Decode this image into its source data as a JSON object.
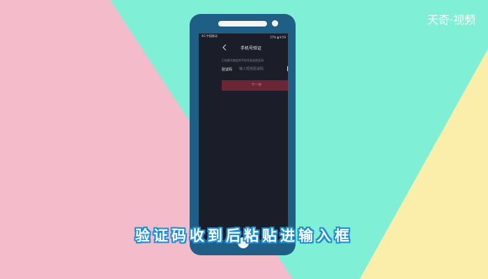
{
  "colors": {
    "pink": "#f4bccb",
    "mint": "#7ff0d6",
    "yellow": "#fbeeaa",
    "phone_body": "#1f5f86",
    "screen": "#1b1e29",
    "next_button": "#6b2535",
    "caption_outline": "#1a8fd8"
  },
  "logo": {
    "text": "天奇·视频"
  },
  "status_bar": {
    "left_text": "4G 中国移动",
    "right_text": "57% ▮ 9:59"
  },
  "nav": {
    "back_icon": "chevron-left-icon",
    "title": "手机号验证"
  },
  "form": {
    "hint": "已向账号绑定的手机号发送验证码",
    "code_label": "验证码",
    "code_placeholder": "输入短信验证码",
    "code_value": ""
  },
  "next_button": {
    "label": "下一步"
  },
  "caption": {
    "text": "验证码收到后粘贴进输入框"
  }
}
